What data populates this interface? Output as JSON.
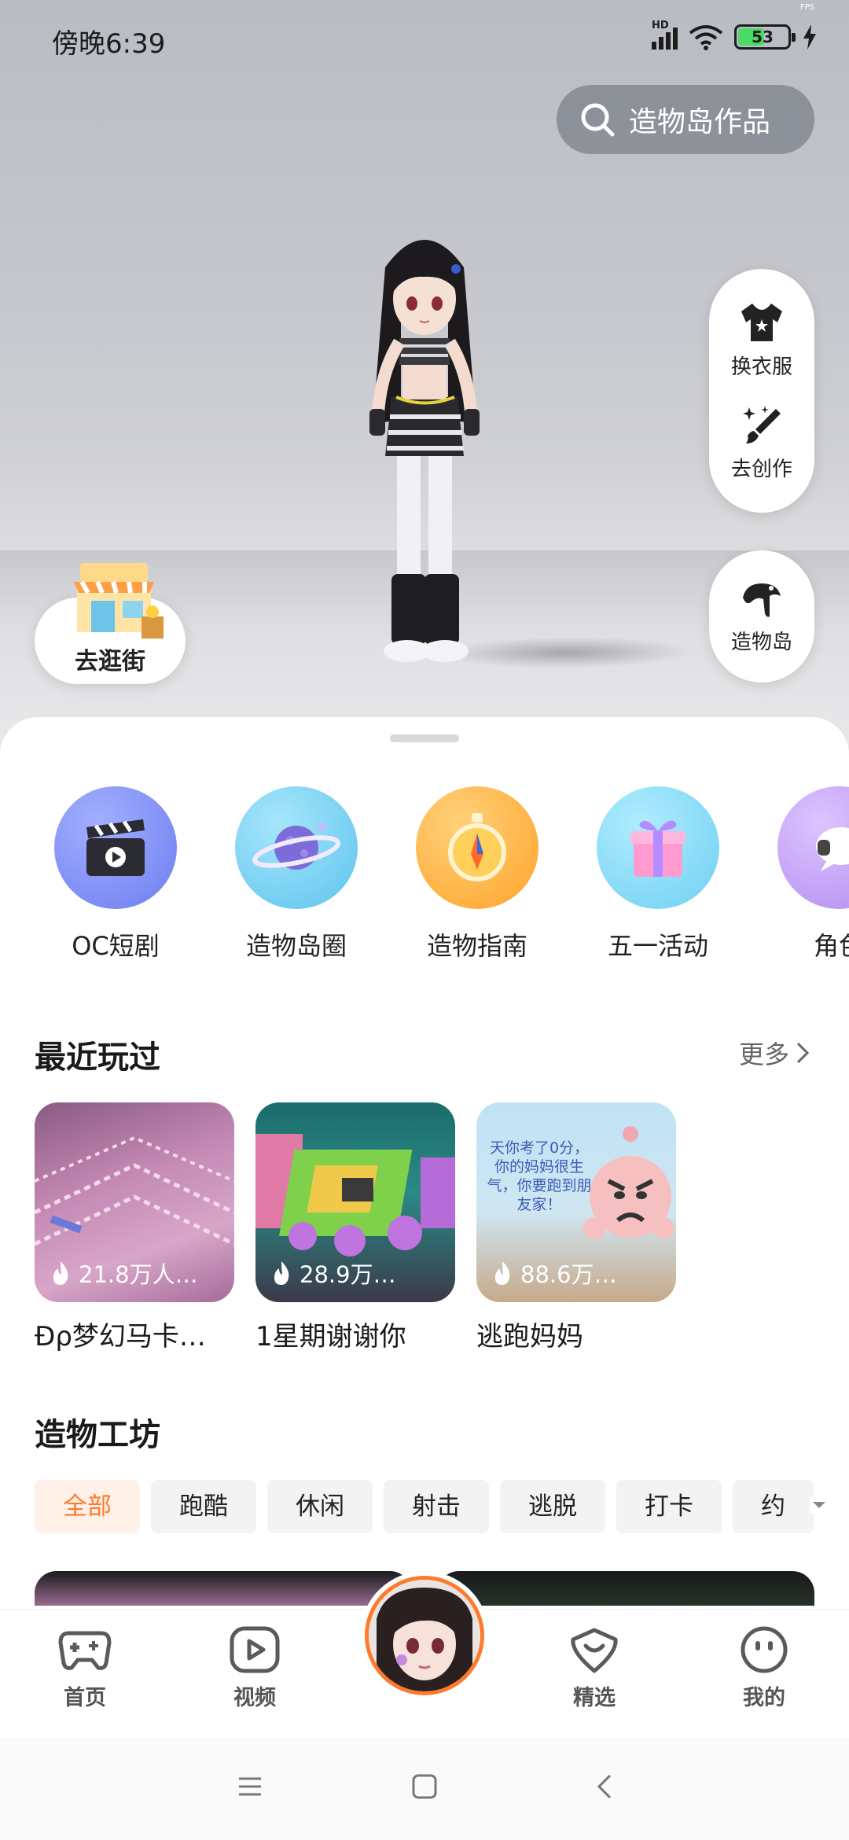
{
  "status_bar": {
    "time": "傍晚6:39",
    "network": "HD",
    "battery": "53",
    "fps": "FPS"
  },
  "search": {
    "label": "造物岛作品",
    "icon": "search-icon"
  },
  "side_actions": [
    {
      "label": "换衣服",
      "icon": "tshirt-icon"
    },
    {
      "label": "去创作",
      "icon": "magic-brush-icon"
    }
  ],
  "island_button": {
    "label": "造物岛",
    "icon": "island-icon"
  },
  "shop_button": {
    "label": "去逛街",
    "icon": "shop-icon"
  },
  "quick_entries": [
    {
      "label": "OC短剧",
      "icon": "clapperboard-icon",
      "color": "#7b8cf5"
    },
    {
      "label": "造物岛圈",
      "icon": "planet-icon",
      "color": "#6fd0f2"
    },
    {
      "label": "造物指南",
      "icon": "compass-icon",
      "color": "#ffb43a"
    },
    {
      "label": "五一活动",
      "icon": "gift-icon",
      "color": "#7fd8f4"
    },
    {
      "label": "角色",
      "icon": "chat-bubble-icon",
      "color": "#c6a0f5"
    }
  ],
  "recent": {
    "title": "最近玩过",
    "more": "更多",
    "items": [
      {
        "name": "Ɖρ梦幻马卡…",
        "stat": "21.8万人…"
      },
      {
        "name": "1星期谢谢你",
        "stat": "28.9万…"
      },
      {
        "name": "逃跑妈妈",
        "stat": "88.6万…",
        "overlay": "天你考了0分，你的妈妈很生气，你要跑到朋友家！"
      }
    ]
  },
  "workshop": {
    "title": "造物工坊",
    "chips": [
      "全部",
      "跑酷",
      "休闲",
      "射击",
      "逃脱",
      "打卡",
      "约"
    ]
  },
  "bottom_nav": [
    {
      "label": "首页",
      "icon": "gamepad-icon"
    },
    {
      "label": "视频",
      "icon": "play-icon"
    },
    {
      "label": "精选",
      "icon": "heart-chat-icon"
    },
    {
      "label": "我的",
      "icon": "smiley-icon"
    }
  ]
}
